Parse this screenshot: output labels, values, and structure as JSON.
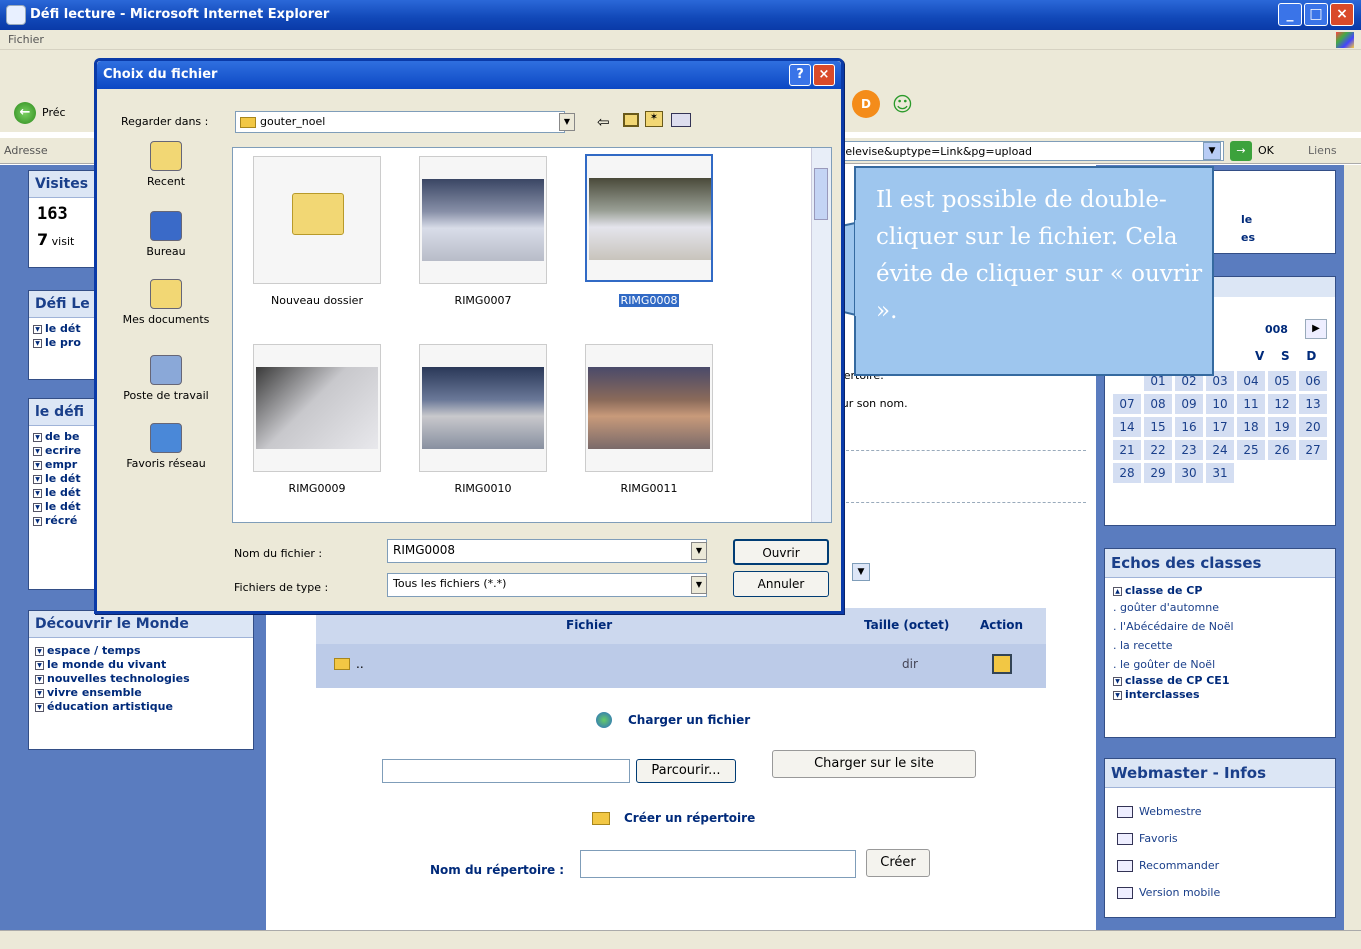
{
  "browser": {
    "window_title": "Défi lecture - Microsoft Internet Explorer",
    "menu_first": "Fichier",
    "back_label": "Préc",
    "address_label": "Adresse",
    "address_value": "televise&uptype=Link&pg=upload",
    "go_label": "OK",
    "links_label": "Liens"
  },
  "left_sidebar": {
    "visites": {
      "title": "Visites",
      "count": "163",
      "count_line2": "7",
      "visit_label": "visit"
    },
    "defi_lecture": {
      "title": "Défi Le",
      "items": [
        "le dét",
        "le pro"
      ]
    },
    "le_defi": {
      "title": "le défi",
      "items": [
        "de be",
        "ecrire",
        "empr",
        "le dét",
        "le dét",
        "le dét",
        "récré"
      ]
    },
    "decouvrir": {
      "title": "Découvrir le Monde",
      "items": [
        "espace / temps",
        "le monde du vivant",
        "nouvelles technologies",
        "vivre ensemble",
        "éducation artistique"
      ]
    }
  },
  "center": {
    "partial_lines": [
      "épertoire.",
      "sur son nom."
    ],
    "table": {
      "col_file": "Fichier",
      "col_size": "Taille (octet)",
      "col_action": "Action",
      "row_name": "..",
      "row_size": "dir"
    },
    "upload_heading": "Charger un fichier",
    "browse_button": "Parcourir...",
    "upload_button": "Charger sur le site",
    "mkdir_heading": "Créer un répertoire",
    "dir_label": "Nom du répertoire :",
    "create_button": "Créer"
  },
  "right_sidebar": {
    "top_partial": [
      "le",
      "es"
    ],
    "calendar": {
      "month_partial": "008",
      "days": [
        "V",
        "S",
        "D"
      ],
      "weeks": [
        [
          "",
          "01",
          "02",
          "03",
          "04",
          "05",
          "06"
        ],
        [
          "07",
          "08",
          "09",
          "10",
          "11",
          "12",
          "13"
        ],
        [
          "14",
          "15",
          "16",
          "17",
          "18",
          "19",
          "20"
        ],
        [
          "21",
          "22",
          "23",
          "24",
          "25",
          "26",
          "27"
        ],
        [
          "28",
          "29",
          "30",
          "31",
          "",
          "",
          ""
        ]
      ]
    },
    "echos": {
      "title": "Echos des classes",
      "group1": "classe de CP",
      "links": [
        ". goûter d'automne",
        ". l'Abécédaire de Noël",
        ". la recette",
        ". le goûter de Noël"
      ],
      "group2": "classe de CP CE1",
      "group3": "interclasses"
    },
    "webmaster": {
      "title": "Webmaster - Infos",
      "links": [
        "Webmestre",
        "Favoris",
        "Recommander",
        "Version mobile"
      ]
    }
  },
  "dialog": {
    "title": "Choix du fichier",
    "help": "?",
    "close": "×",
    "lookin_label": "Regarder dans :",
    "lookin_value": "gouter_noel",
    "places": [
      "Recent",
      "Bureau",
      "Mes documents",
      "Poste de travail",
      "Favoris réseau"
    ],
    "files": [
      "Nouveau dossier",
      "RIMG0007",
      "RIMG0008",
      "RIMG0009",
      "RIMG0010",
      "RIMG0011"
    ],
    "filename_label": "Nom du fichier :",
    "filename_value": "RIMG0008",
    "filetype_label": "Fichiers de type :",
    "filetype_value": "Tous les fichiers (*.*)",
    "open_button": "Ouvrir",
    "cancel_button": "Annuler"
  },
  "callout": {
    "text": "Il est possible de double-cliquer sur le fichier. Cela évite de cliquer sur « ouvrir »."
  }
}
